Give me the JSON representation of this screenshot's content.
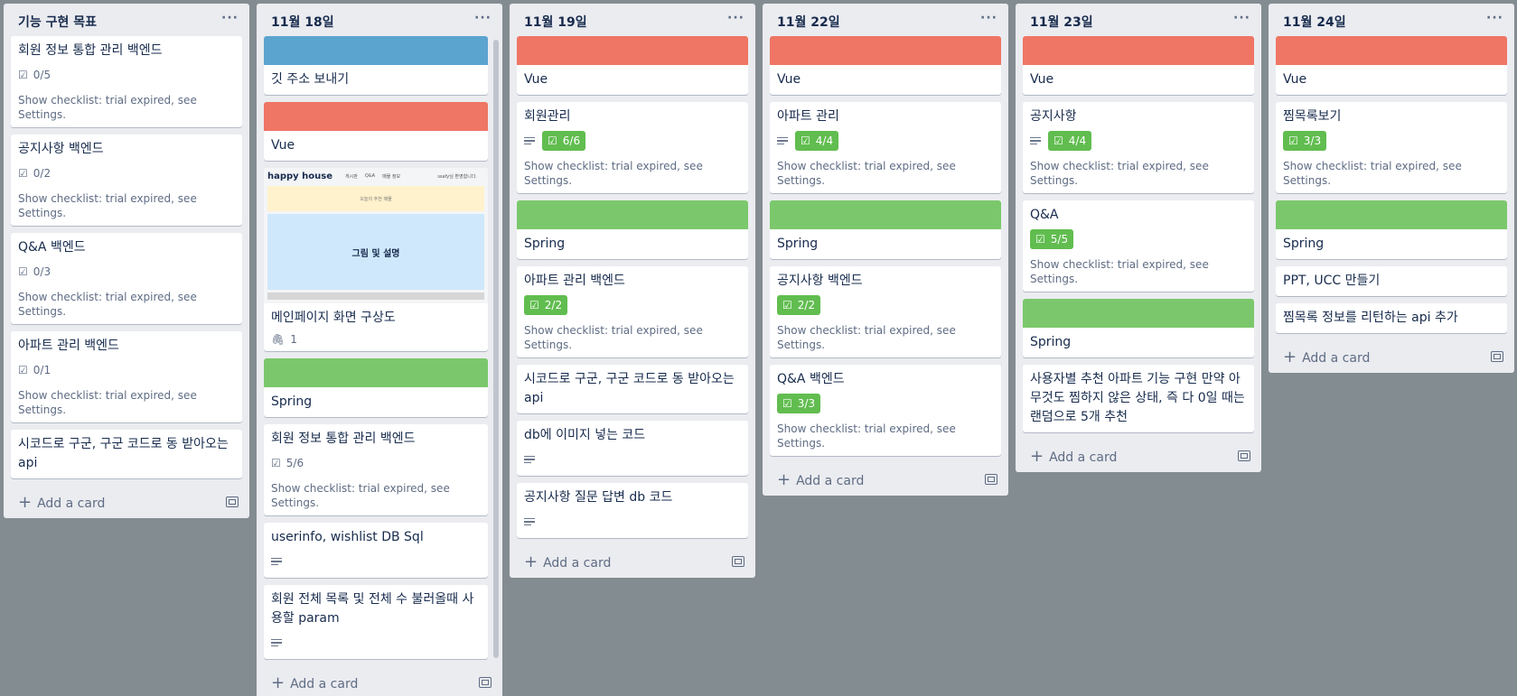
{
  "colors": {
    "board": "#838c91",
    "blue_label": "#5ba4cf",
    "red_label": "#ef7564",
    "green_label": "#7bc86c",
    "done_badge": "#61bd4f"
  },
  "icons": {
    "list_menu": "ellipsis-icon",
    "checklist": "checklist-icon",
    "description": "description-icon",
    "attachment": "paperclip-icon",
    "add": "plus-icon",
    "template": "card-template-icon"
  },
  "common": {
    "menu": "···",
    "add_card": "Add a card",
    "trial_note": "Show checklist: trial expired, see Settings."
  },
  "lists": [
    {
      "title": "기능 구현 목표",
      "cards": [
        {
          "title": "회원 정보 통합 관리 백엔드",
          "checklist": "0/5"
        },
        {
          "title": "공지사항 백엔드",
          "checklist": "0/2"
        },
        {
          "title": "Q&A 백엔드",
          "checklist": "0/3"
        },
        {
          "title": "아파트 관리 백엔드",
          "checklist": "0/1"
        },
        {
          "title": "시코드로 구군, 구군 코드로 동 받아오는 api"
        }
      ]
    },
    {
      "title": "11월 18일",
      "cards": [
        {
          "title": "깃 주소 보내기"
        },
        {
          "title": "Vue"
        },
        {
          "title": "메인페이지 화면 구상도",
          "attachments": "1",
          "image": {
            "brand": "happy house",
            "nav": [
              "게시판",
              "Q&A",
              "매물 정보"
            ],
            "user": "ssafy님 환영합니다.",
            "banner": "오늘의 추천 매물",
            "caption": "그림 및 설명"
          }
        },
        {
          "title": "Spring"
        },
        {
          "title": "회원 정보 통합 관리 백엔드",
          "checklist": "5/6"
        },
        {
          "title": "userinfo, wishlist DB Sql"
        },
        {
          "title": "회원 전체 목록 및 전체 수 불러올때 사용할 param"
        }
      ]
    },
    {
      "title": "11월 19일",
      "cards": [
        {
          "title": "Vue"
        },
        {
          "title": "회원관리",
          "checklist": "6/6"
        },
        {
          "title": "Spring"
        },
        {
          "title": "아파트 관리 백엔드",
          "checklist": "2/2"
        },
        {
          "title": "시코드로 구군, 구군 코드로 동 받아오는 api"
        },
        {
          "title": "db에 이미지 넣는 코드"
        },
        {
          "title": "공지사항 질문 답변 db 코드"
        }
      ]
    },
    {
      "title": "11월 22일",
      "cards": [
        {
          "title": "Vue"
        },
        {
          "title": "아파트 관리",
          "checklist": "4/4"
        },
        {
          "title": "Spring"
        },
        {
          "title": "공지사항 백엔드",
          "checklist": "2/2"
        },
        {
          "title": "Q&A 백엔드",
          "checklist": "3/3"
        }
      ]
    },
    {
      "title": "11월 23일",
      "cards": [
        {
          "title": "Vue"
        },
        {
          "title": "공지사항",
          "checklist": "4/4"
        },
        {
          "title": "Q&A",
          "checklist": "5/5"
        },
        {
          "title": "Spring"
        },
        {
          "title": "사용자별 추천 아파트 기능 구현 만약 아무것도 찜하지 않은 상태, 즉 다 0일 때는 랜덤으로 5개 추천"
        }
      ]
    },
    {
      "title": "11월 24일",
      "cards": [
        {
          "title": "Vue"
        },
        {
          "title": "찜목록보기",
          "checklist": "3/3"
        },
        {
          "title": "Spring"
        },
        {
          "title": "PPT, UCC 만들기"
        },
        {
          "title": "찜목록 정보를 리턴하는 api 추가"
        }
      ]
    }
  ]
}
